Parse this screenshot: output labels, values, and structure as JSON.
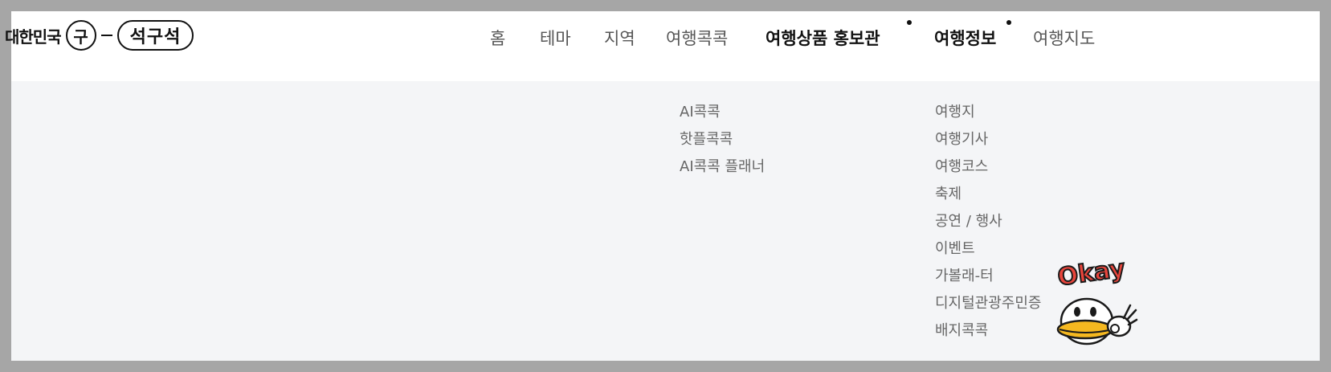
{
  "logo": {
    "prefix": "대한민국",
    "circle_char": "구",
    "pill_text": "석구석"
  },
  "nav": {
    "items": [
      {
        "label": "홈"
      },
      {
        "label": "테마"
      },
      {
        "label": "지역"
      },
      {
        "label": "여행콕콕"
      },
      {
        "label": "여행상품 홍보관"
      },
      {
        "label": "여행정보"
      },
      {
        "label": "여행지도"
      }
    ]
  },
  "submenus": {
    "travel_kokkok": [
      "AI콕콕",
      "핫플콕콕",
      "AI콕콕 플래너"
    ],
    "travel_info": [
      "여행지",
      "여행기사",
      "여행코스",
      "축제",
      "공연 / 행사",
      "이벤트",
      "가볼래-터",
      "디지털관광주민증",
      "배지콕콕"
    ]
  },
  "mascot": {
    "icon": "okay-duck-mascot-icon",
    "text": "Okay"
  },
  "colors": {
    "backdrop": "#a6a6a6",
    "header_bg": "#ffffff",
    "dropdown_bg": "#f4f5f7",
    "mascot_red": "#e8453c",
    "mascot_yellow": "#f5b820"
  }
}
